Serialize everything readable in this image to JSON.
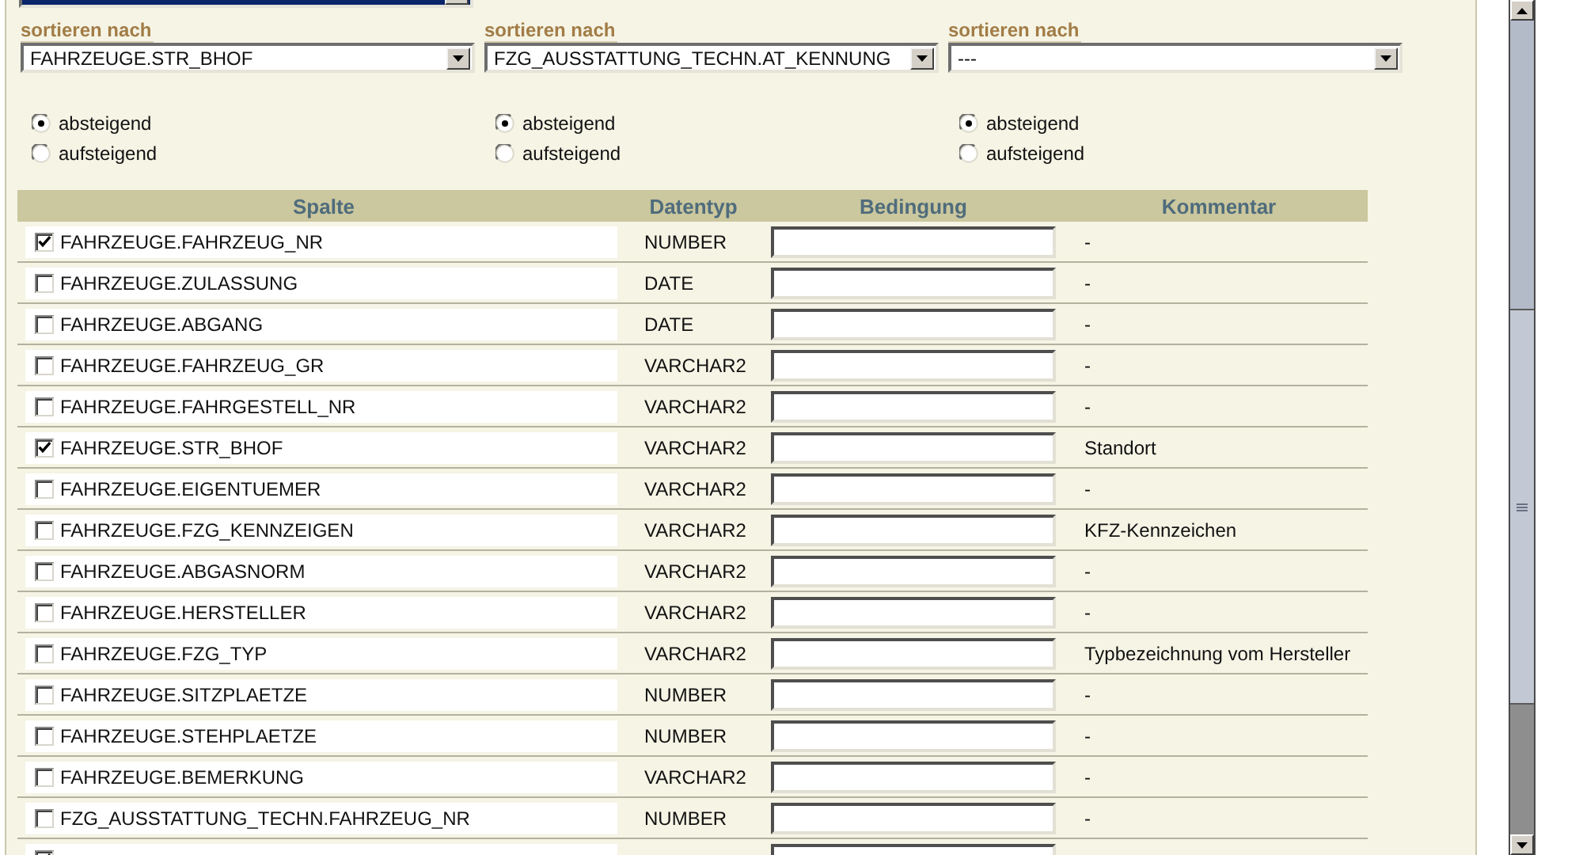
{
  "top_select": {
    "highlighted": true
  },
  "sort_fields": [
    {
      "label": "sortieren nach",
      "value": "FAHRZEUGE.STR_BHOF",
      "orders": [
        {
          "label": "absteigend",
          "selected": true
        },
        {
          "label": "aufsteigend",
          "selected": false
        }
      ]
    },
    {
      "label": "sortieren nach",
      "value": "FZG_AUSSTATTUNG_TECHN.AT_KENNUNG",
      "orders": [
        {
          "label": "absteigend",
          "selected": true
        },
        {
          "label": "aufsteigend",
          "selected": false
        }
      ]
    },
    {
      "label": "sortieren nach",
      "value": "---",
      "orders": [
        {
          "label": "absteigend",
          "selected": true
        },
        {
          "label": "aufsteigend",
          "selected": false
        }
      ]
    }
  ],
  "table": {
    "columns": [
      "Spalte",
      "Datentyp",
      "Bedingung",
      "Kommentar"
    ],
    "rows": [
      {
        "checked": true,
        "column": "FAHRZEUGE.FAHRZEUG_NR",
        "datatype": "NUMBER",
        "comment": "-"
      },
      {
        "checked": false,
        "column": "FAHRZEUGE.ZULASSUNG",
        "datatype": "DATE",
        "comment": "-"
      },
      {
        "checked": false,
        "column": "FAHRZEUGE.ABGANG",
        "datatype": "DATE",
        "comment": "-"
      },
      {
        "checked": false,
        "column": "FAHRZEUGE.FAHRZEUG_GR",
        "datatype": "VARCHAR2",
        "comment": "-"
      },
      {
        "checked": false,
        "column": "FAHRZEUGE.FAHRGESTELL_NR",
        "datatype": "VARCHAR2",
        "comment": "-"
      },
      {
        "checked": true,
        "column": "FAHRZEUGE.STR_BHOF",
        "datatype": "VARCHAR2",
        "comment": "Standort"
      },
      {
        "checked": false,
        "column": "FAHRZEUGE.EIGENTUEMER",
        "datatype": "VARCHAR2",
        "comment": "-"
      },
      {
        "checked": false,
        "column": "FAHRZEUGE.FZG_KENNZEIGEN",
        "datatype": "VARCHAR2",
        "comment": "KFZ-Kennzeichen"
      },
      {
        "checked": false,
        "column": "FAHRZEUGE.ABGASNORM",
        "datatype": "VARCHAR2",
        "comment": "-"
      },
      {
        "checked": false,
        "column": "FAHRZEUGE.HERSTELLER",
        "datatype": "VARCHAR2",
        "comment": "-"
      },
      {
        "checked": false,
        "column": "FAHRZEUGE.FZG_TYP",
        "datatype": "VARCHAR2",
        "comment": "Typbezeichnung vom Hersteller"
      },
      {
        "checked": false,
        "column": "FAHRZEUGE.SITZPLAETZE",
        "datatype": "NUMBER",
        "comment": "-"
      },
      {
        "checked": false,
        "column": "FAHRZEUGE.STEHPLAETZE",
        "datatype": "NUMBER",
        "comment": "-"
      },
      {
        "checked": false,
        "column": "FAHRZEUGE.BEMERKUNG",
        "datatype": "VARCHAR2",
        "comment": "-"
      },
      {
        "checked": false,
        "column": "FZG_AUSSTATTUNG_TECHN.FAHRZEUG_NR",
        "datatype": "NUMBER",
        "comment": "-"
      },
      {
        "checked": true
      }
    ]
  }
}
